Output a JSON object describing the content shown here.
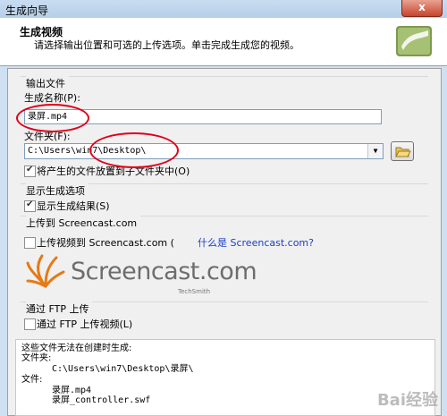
{
  "window": {
    "title": "生成向导",
    "close_glyph": "x"
  },
  "header": {
    "title": "生成视频",
    "subtitle": "请选择输出位置和可选的上传选项。单击完成生成您的视频。"
  },
  "output": {
    "group_label": "输出文件",
    "name_label": "生成名称(P):",
    "name_value": "录屏.mp4",
    "folder_label": "文件夹(F):",
    "folder_value": "C:\\Users\\win7\\Desktop\\",
    "subfolder_label": "将产生的文件放置到子文件夹中(O)",
    "subfolder_checked": true
  },
  "display": {
    "group_label": "显示生成选项",
    "show_results_label": "显示生成结果(S)",
    "show_results_checked": true
  },
  "upload": {
    "group_label": "上传到 Screencast.com",
    "upload_label": "上传视频到 Screencast.com (",
    "what_is_link": "什么是 Screencast.com?",
    "upload_checked": false,
    "brand_name": "Screencast.com",
    "brand_sub": "TechSmith"
  },
  "ftp": {
    "group_label": "通过 FTP 上传",
    "ftp_label": "通过 FTP 上传视频(L)",
    "ftp_checked": false
  },
  "summary": {
    "line1": "这些文件无法在创建时生成:",
    "folder_heading": "文件夹:",
    "folder_path": "C:\\Users\\win7\\Desktop\\录屏\\",
    "files_heading": "文件:",
    "file1": "录屏.mp4",
    "file2": "录屏_controller.swf"
  },
  "watermark": "Bai经验"
}
